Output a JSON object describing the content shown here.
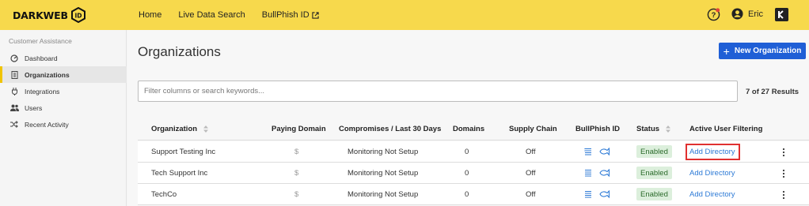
{
  "header": {
    "logo_text": "DARKWEB",
    "logo_badge": "ID",
    "nav": [
      "Home",
      "Live Data Search",
      "BullPhish ID"
    ],
    "user_name": "Eric",
    "accent_color": "#f7d94c"
  },
  "sidebar": {
    "section_title": "Customer Assistance",
    "items": [
      {
        "label": "Dashboard",
        "icon": "dashboard-icon"
      },
      {
        "label": "Organizations",
        "icon": "building-icon",
        "active": true
      },
      {
        "label": "Integrations",
        "icon": "plug-icon"
      },
      {
        "label": "Users",
        "icon": "users-icon"
      },
      {
        "label": "Recent Activity",
        "icon": "shuffle-icon"
      }
    ]
  },
  "main": {
    "title": "Organizations",
    "new_button": "New Organization",
    "search_placeholder": "Filter columns or search keywords...",
    "results": "7 of 27 Results",
    "columns": [
      "Organization",
      "Paying Domain",
      "Compromises / Last 30 Days",
      "Domains",
      "Supply Chain",
      "BullPhish ID",
      "Status",
      "Active User Filtering"
    ],
    "rows": [
      {
        "org": "Support Testing Inc",
        "paying": "$",
        "compromises": "Monitoring Not Setup",
        "domains": "0",
        "supply": "Off",
        "status": "Enabled",
        "filtering": "Add Directory",
        "highlighted": true
      },
      {
        "org": "Tech Support Inc",
        "paying": "$",
        "compromises": "Monitoring Not Setup",
        "domains": "0",
        "supply": "Off",
        "status": "Enabled",
        "filtering": "Add Directory"
      },
      {
        "org": "TechCo",
        "paying": "$",
        "compromises": "Monitoring Not Setup",
        "domains": "0",
        "supply": "Off",
        "status": "Enabled",
        "filtering": "Add Directory"
      }
    ]
  }
}
